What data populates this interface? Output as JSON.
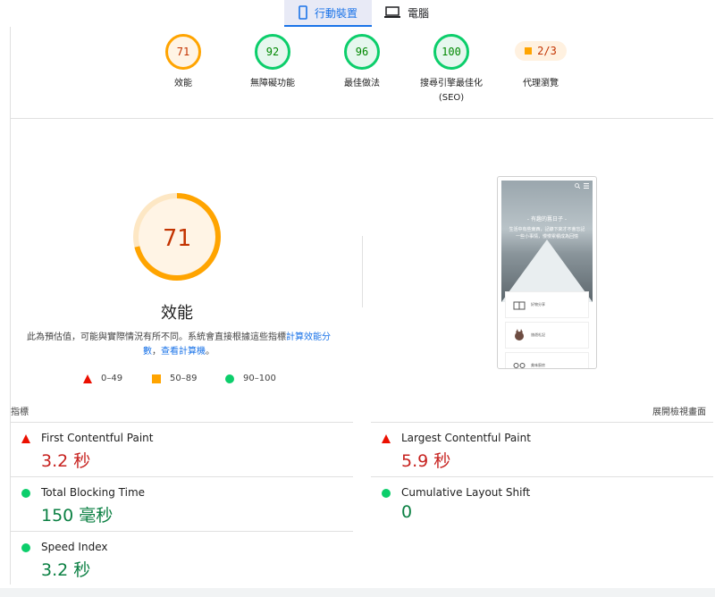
{
  "tabs": [
    {
      "label": "行動裝置",
      "icon": "mobile-icon",
      "active": true
    },
    {
      "label": "電腦",
      "icon": "desktop-icon",
      "active": false
    }
  ],
  "gauges": [
    {
      "score": "71",
      "label": "效能",
      "status": "orange"
    },
    {
      "score": "92",
      "label": "無障礙功能",
      "status": "green"
    },
    {
      "score": "96",
      "label": "最佳做法",
      "status": "green"
    },
    {
      "score": "100",
      "label": "搜尋引擎最佳化",
      "label2": "(SEO)",
      "status": "green"
    }
  ],
  "pwa": {
    "value": "2/3",
    "label": "代理瀏覽"
  },
  "performance": {
    "score": "71",
    "score_fraction": 0.71,
    "title": "效能",
    "desc_text": "此為預估值，可能與實際情況有所不同。系統會直接根據這些指標",
    "desc_link1": "計算效能分數",
    "desc_sep": "，",
    "desc_link2": "查看計算機",
    "desc_end": "。"
  },
  "legend": [
    {
      "range": "0–49",
      "icon": "triangle-icon",
      "color": "#eb0f00"
    },
    {
      "range": "50–89",
      "icon": "square-icon",
      "color": "#ffa400"
    },
    {
      "range": "90–100",
      "icon": "circle-icon",
      "color": "#0cce6b"
    }
  ],
  "screenshot": {
    "title": "- 有趣的舊日子 -",
    "lines": [
      "生活中有些東西，記錄下來才不會忘記",
      "一些小事情，慢慢累積成為回憶"
    ],
    "cards": [
      "好物分享",
      "旅遊札記",
      "美味廚房"
    ]
  },
  "metrics_section": {
    "label": "指標",
    "expand": "展開檢視畫面"
  },
  "metrics": [
    {
      "name": "First Contentful Paint",
      "value": "3.2 秒",
      "status": "red"
    },
    {
      "name": "Largest Contentful Paint",
      "value": "5.9 秒",
      "status": "red"
    },
    {
      "name": "Total Blocking Time",
      "value": "150 毫秒",
      "status": "green"
    },
    {
      "name": "Cumulative Layout Shift",
      "value": "0",
      "status": "green"
    },
    {
      "name": "Speed Index",
      "value": "3.2 秒",
      "status": "green"
    }
  ]
}
